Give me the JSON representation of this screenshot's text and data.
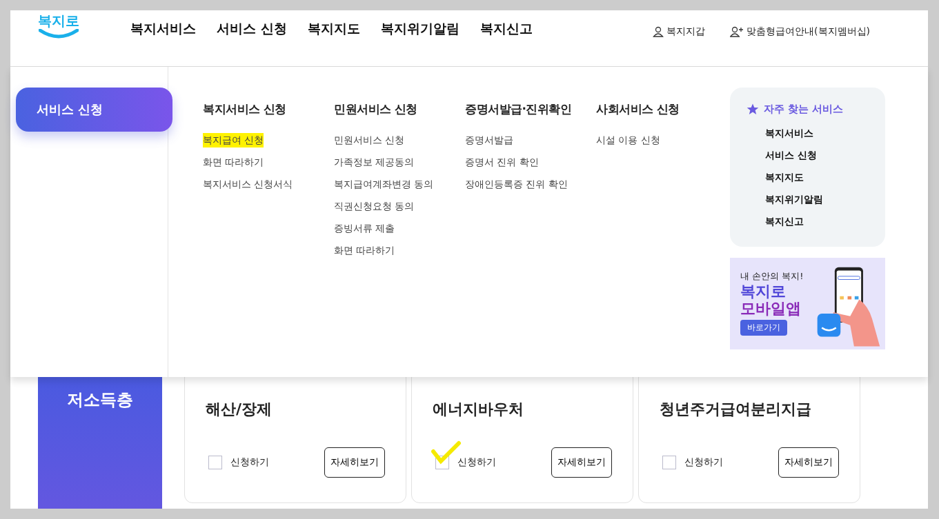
{
  "header": {
    "logo": "복지로",
    "nav": [
      "복지서비스",
      "서비스 신청",
      "복지지도",
      "복지위기알림",
      "복지신고"
    ],
    "utility": [
      {
        "kind": "person",
        "label": "복지지갑"
      },
      {
        "kind": "person-add",
        "label": "맞춤형급여안내(복지멤버십)"
      }
    ]
  },
  "mega_menu": {
    "active_button": "서비스 신청",
    "columns": [
      {
        "title": "복지서비스 신청",
        "items": [
          {
            "label": "복지급여 신청",
            "selected": true
          },
          {
            "label": "화면 따라하기",
            "selected": false
          },
          {
            "label": "복지서비스 신청서식",
            "selected": false
          }
        ]
      },
      {
        "title": "민원서비스 신청",
        "items": [
          {
            "label": "민원서비스 신청",
            "selected": false
          },
          {
            "label": "가족정보 제공동의",
            "selected": false
          },
          {
            "label": "복지급여계좌변경 동의",
            "selected": false
          },
          {
            "label": "직권신청요청 동의",
            "selected": false
          },
          {
            "label": "증빙서류 제출",
            "selected": false
          },
          {
            "label": "화면 따라하기",
            "selected": false
          }
        ]
      },
      {
        "title": "증명서발급·진위확인",
        "items": [
          {
            "label": "증명서발급",
            "selected": false
          },
          {
            "label": "증명서 진위 확인",
            "selected": false
          },
          {
            "label": "장애인등록증 진위 확인",
            "selected": false
          }
        ]
      },
      {
        "title": "사회서비스 신청",
        "items": [
          {
            "label": "시설 이용 신청",
            "selected": false
          }
        ]
      }
    ],
    "favorites": {
      "title": "자주 찾는 서비스",
      "items": [
        "복지서비스",
        "서비스 신청",
        "복지지도",
        "복지위기알림",
        "복지신고"
      ]
    },
    "banner": {
      "line1": "내 손안의 복지!",
      "line2": "복지로",
      "line3": "모바일앱",
      "button": "바로가기"
    }
  },
  "category": "저소득층",
  "cards": [
    {
      "title": "해산/장제",
      "apply": "신청하기",
      "checked": false,
      "detail": "자세히보기"
    },
    {
      "title": "에너지바우처",
      "apply": "신청하기",
      "checked": true,
      "detail": "자세히보기"
    },
    {
      "title": "청년주거급여분리지급",
      "apply": "신청하기",
      "checked": false,
      "detail": "자세히보기"
    }
  ]
}
